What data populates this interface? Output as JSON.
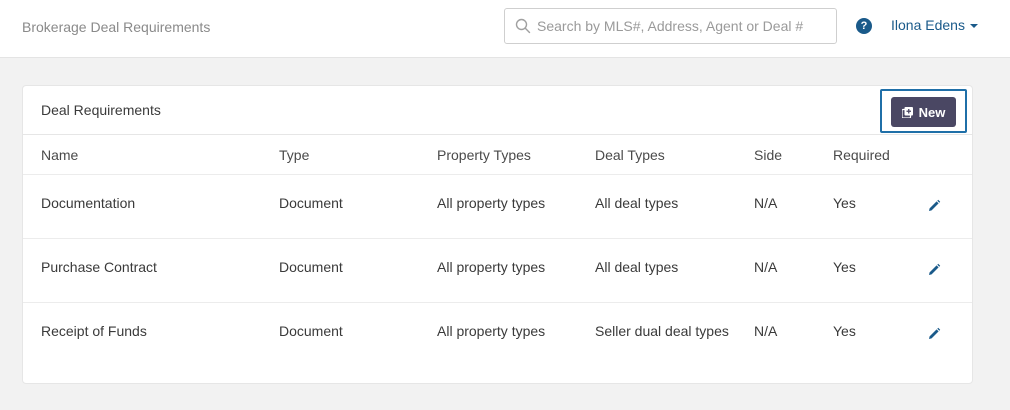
{
  "header": {
    "app_title": "Brokerage Deal Requirements",
    "search_placeholder": "Search by MLS#, Address, Agent or Deal #",
    "search_value": "",
    "help_icon_glyph": "?",
    "user_name": "Ilona Edens"
  },
  "card": {
    "title": "Deal Requirements",
    "new_button_label": "New"
  },
  "table": {
    "columns": [
      "Name",
      "Type",
      "Property Types",
      "Deal Types",
      "Side",
      "Required"
    ],
    "rows": [
      {
        "name": "Documentation",
        "type": "Document",
        "property_types": "All property types",
        "deal_types": "All deal types",
        "side": "N/A",
        "required": "Yes"
      },
      {
        "name": "Purchase Contract",
        "type": "Document",
        "property_types": "All property types",
        "deal_types": "All deal types",
        "side": "N/A",
        "required": "Yes"
      },
      {
        "name": "Receipt of Funds",
        "type": "Document",
        "property_types": "All property types",
        "deal_types": "Seller dual deal types",
        "side": "N/A",
        "required": "Yes"
      }
    ]
  },
  "colors": {
    "accent": "#1a5a8a",
    "button_bg": "#4a4763",
    "focus_outline": "#1f6fa8"
  },
  "icons": {
    "search": "search-icon",
    "help": "question-circle-icon",
    "new": "add-copy-icon",
    "edit": "pencil-icon",
    "caret": "caret-down-icon"
  }
}
